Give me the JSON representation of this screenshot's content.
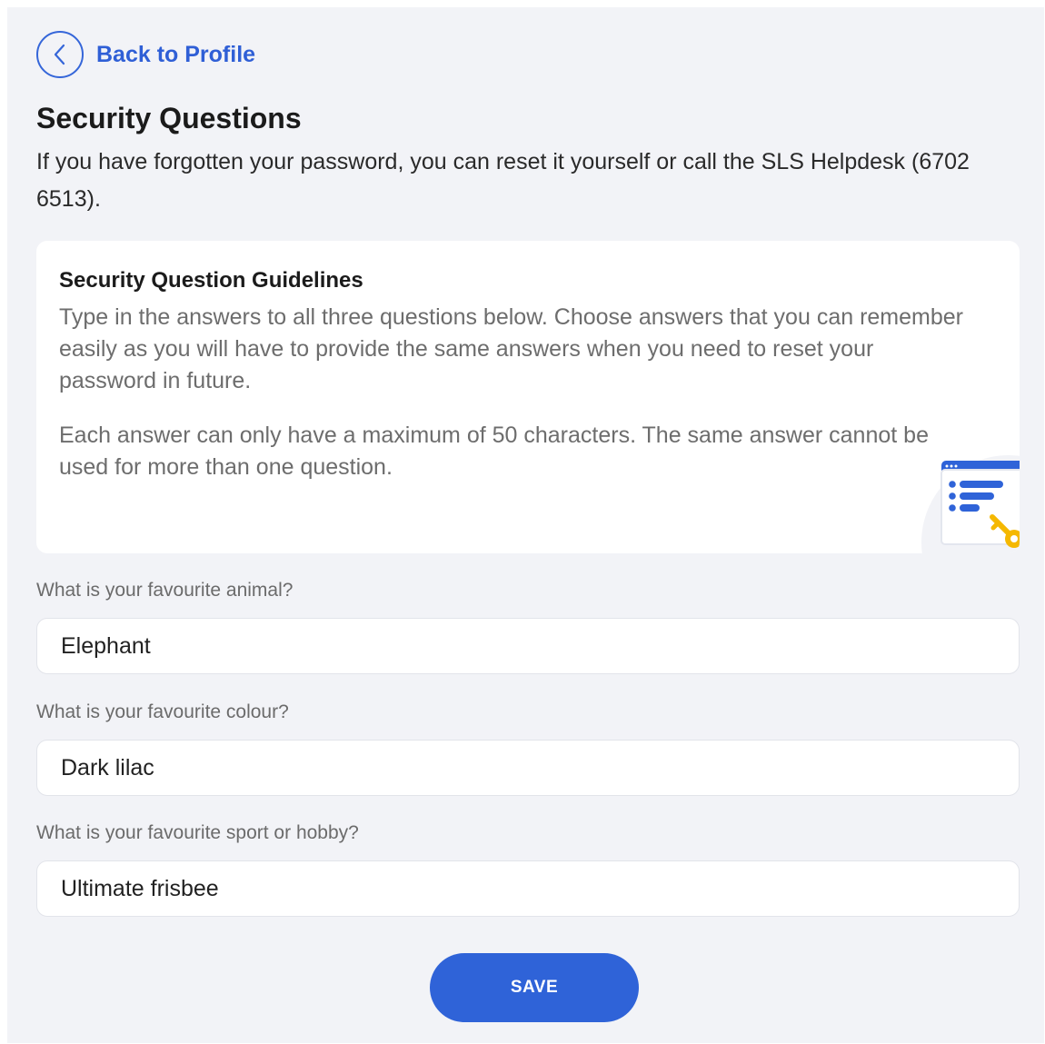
{
  "nav": {
    "back_label": "Back to Profile",
    "back_icon": "chevron-left-icon"
  },
  "page": {
    "title": "Security Questions",
    "subtitle": "If you have forgotten your password, you can reset it yourself or call the SLS Helpdesk (6702 6513)."
  },
  "guidelines": {
    "title": "Security Question Guidelines",
    "paragraph1": "Type in the answers to all three questions below. Choose answers that you can remember easily as you will have to provide the same answers when you need to reset your password in future.",
    "paragraph2": "Each answer can only have a maximum of 50 characters. The same answer cannot be used for more than one question.",
    "illustration_icon": "document-key-icon"
  },
  "questions": [
    {
      "label": "What is your favourite animal?",
      "value": "Elephant"
    },
    {
      "label": "What is your favourite colour?",
      "value": "Dark lilac"
    },
    {
      "label": "What is your favourite sport or hobby?",
      "value": "Ultimate frisbee"
    }
  ],
  "actions": {
    "save_label": "SAVE"
  },
  "colors": {
    "accent": "#2f63d8",
    "background": "#f2f3f7",
    "card": "#ffffff",
    "key_yellow": "#f5b800"
  }
}
